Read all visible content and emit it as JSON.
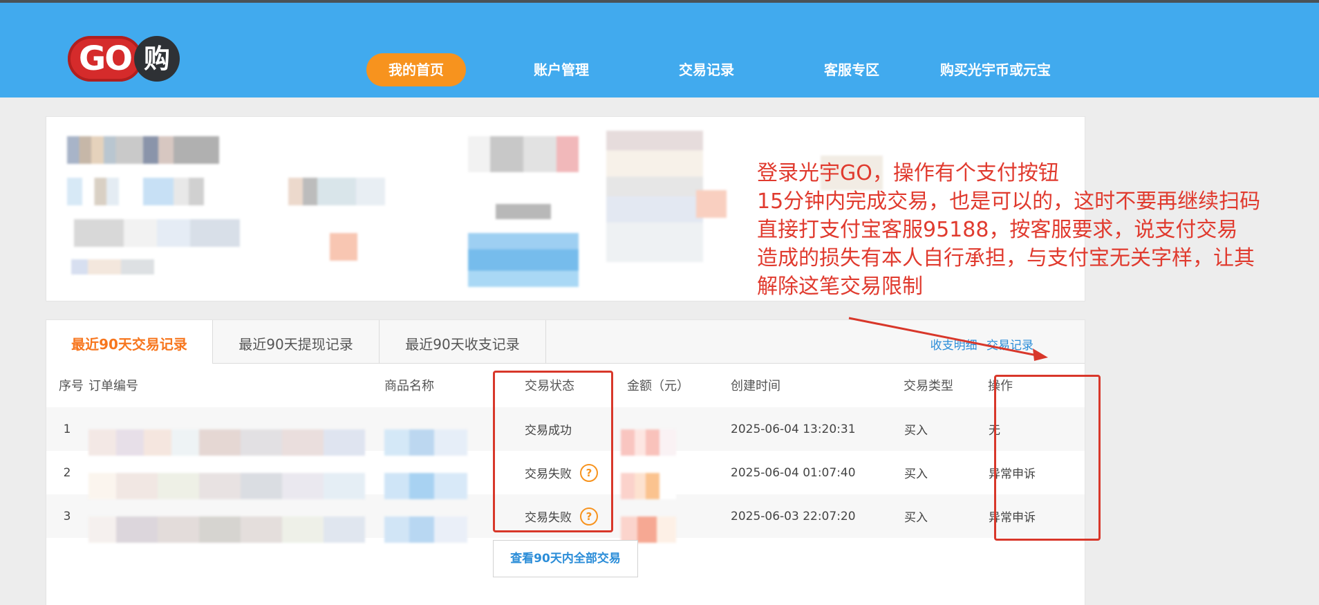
{
  "logo": {
    "go": "GO",
    "gou": "购"
  },
  "nav": [
    {
      "label": "我的首页",
      "active": true
    },
    {
      "label": "账户管理",
      "active": false
    },
    {
      "label": "交易记录",
      "active": false
    },
    {
      "label": "客服专区",
      "active": false
    },
    {
      "label": "购买光宇币或元宝",
      "active": false
    }
  ],
  "tabs": [
    {
      "label": "最近90天交易记录",
      "active": true
    },
    {
      "label": "最近90天提现记录",
      "active": false
    },
    {
      "label": "最近90天收支记录",
      "active": false
    }
  ],
  "links": {
    "income_detail": "收支明细",
    "trade_record": "交易记录"
  },
  "table": {
    "headers": [
      "序号",
      "订单编号",
      "商品名称",
      "交易状态",
      "金额（元）",
      "创建时间",
      "交易类型",
      "操作"
    ],
    "rows": [
      {
        "index": "1",
        "status": "交易成功",
        "time": "2025-06-04 13:20:31",
        "type": "买入",
        "action": "无"
      },
      {
        "index": "2",
        "status": "交易失败",
        "time": "2025-06-04 01:07:40",
        "type": "买入",
        "action": "异常申诉"
      },
      {
        "index": "3",
        "status": "交易失败",
        "time": "2025-06-03 22:07:20",
        "type": "买入",
        "action": "异常申诉"
      }
    ]
  },
  "view_all": "查看90天内全部交易",
  "annotation": "登录光宇GO，操作有个支付按钮\n15分钟内完成交易，也是可以的，这时不要再继续扫码\n直接打支付宝客服95188，按客服要求，说支付交易\n造成的损失有本人自行承担，与支付宝无关字样，让其\n解除这笔交易限制",
  "colors": {
    "header": "#41aaee",
    "accent": "#f7931e",
    "link": "#2b8dd8",
    "annotation": "#e03a2e"
  }
}
